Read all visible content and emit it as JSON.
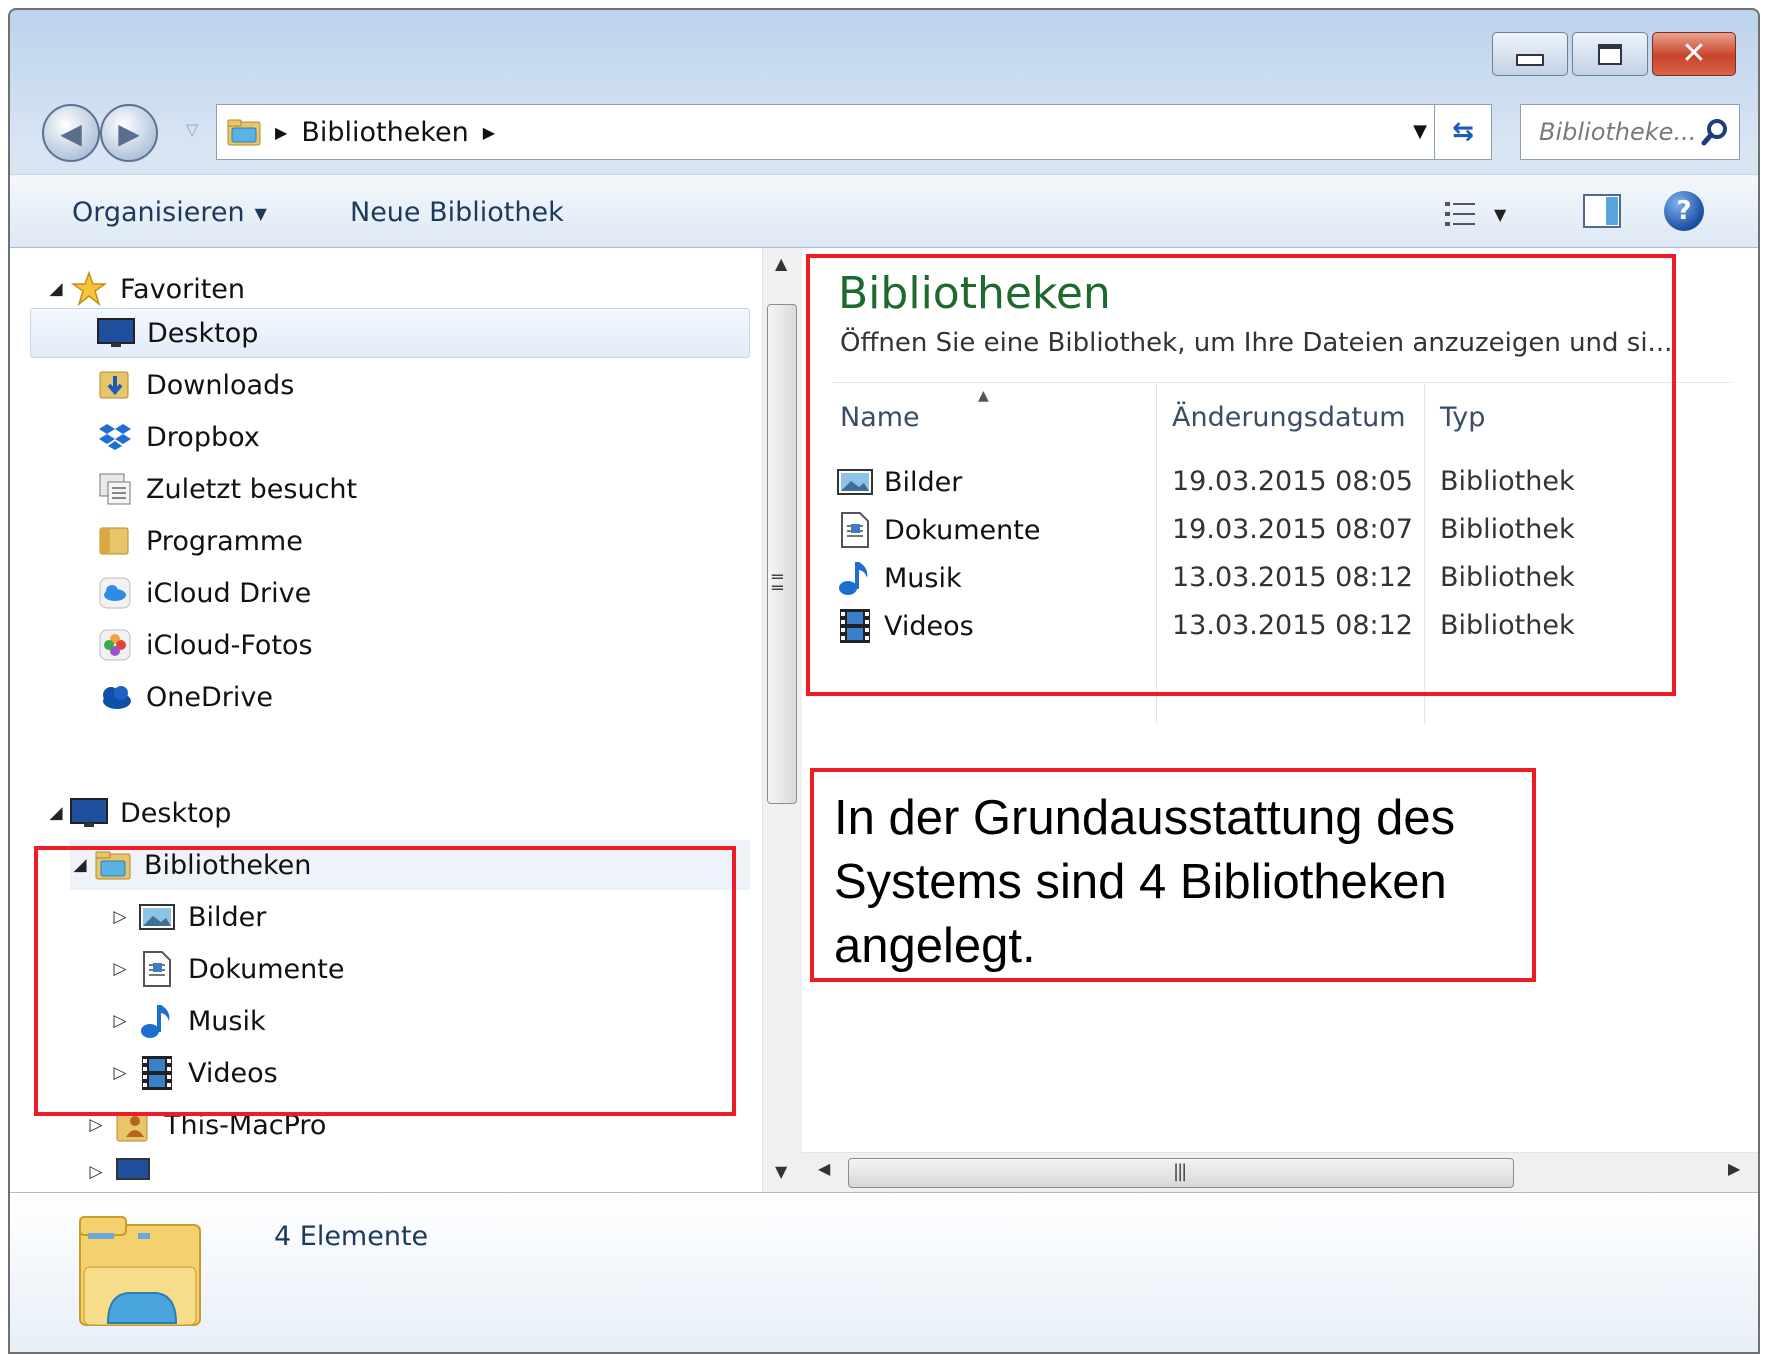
{
  "window": {
    "caption_buttons": {
      "minimize": "minimize",
      "maximize": "maximize",
      "close": "close"
    }
  },
  "address_bar": {
    "breadcrumb": [
      "Bibliotheken"
    ],
    "search_placeholder": "Bibliotheke..."
  },
  "command_bar": {
    "organize_label": "Organisieren",
    "new_library_label": "Neue Bibliothek"
  },
  "nav_pane": {
    "favorites": {
      "label": "Favoriten",
      "items": [
        {
          "label": "Desktop",
          "icon": "desktop-icon"
        },
        {
          "label": "Downloads",
          "icon": "downloads-icon"
        },
        {
          "label": "Dropbox",
          "icon": "dropbox-icon"
        },
        {
          "label": "Zuletzt besucht",
          "icon": "recent-places-icon"
        },
        {
          "label": "Programme",
          "icon": "folder-icon"
        },
        {
          "label": "iCloud Drive",
          "icon": "icloud-drive-icon"
        },
        {
          "label": "iCloud-Fotos",
          "icon": "icloud-photos-icon"
        },
        {
          "label": "OneDrive",
          "icon": "onedrive-icon"
        }
      ]
    },
    "desktop": {
      "label": "Desktop",
      "libraries": {
        "label": "Bibliotheken",
        "items": [
          {
            "label": "Bilder",
            "icon": "pictures-library-icon"
          },
          {
            "label": "Dokumente",
            "icon": "documents-library-icon"
          },
          {
            "label": "Musik",
            "icon": "music-library-icon"
          },
          {
            "label": "Videos",
            "icon": "videos-library-icon"
          }
        ]
      },
      "after": [
        {
          "label": "This-MacPro",
          "icon": "user-folder-icon"
        }
      ]
    }
  },
  "content": {
    "title": "Bibliotheken",
    "subtitle": "Öffnen Sie eine Bibliothek, um Ihre Dateien anzuzeigen und si...",
    "columns": [
      "Name",
      "Änderungsdatum",
      "Typ"
    ],
    "rows": [
      {
        "name": "Bilder",
        "date": "19.03.2015 08:05",
        "type": "Bibliothek",
        "icon": "pictures-library-icon"
      },
      {
        "name": "Dokumente",
        "date": "19.03.2015 08:07",
        "type": "Bibliothek",
        "icon": "documents-library-icon"
      },
      {
        "name": "Musik",
        "date": "13.03.2015 08:12",
        "type": "Bibliothek",
        "icon": "music-library-icon"
      },
      {
        "name": "Videos",
        "date": "13.03.2015 08:12",
        "type": "Bibliothek",
        "icon": "videos-library-icon"
      }
    ]
  },
  "details": {
    "count_label": "4 Elemente"
  },
  "annotation": {
    "text": "In der Grundausstattung des Systems sind 4 Bibliotheken angelegt."
  },
  "colors": {
    "annotation_red": "#ee1c24",
    "title_green": "#1e6a2e",
    "nav_text": "#1e395b"
  }
}
